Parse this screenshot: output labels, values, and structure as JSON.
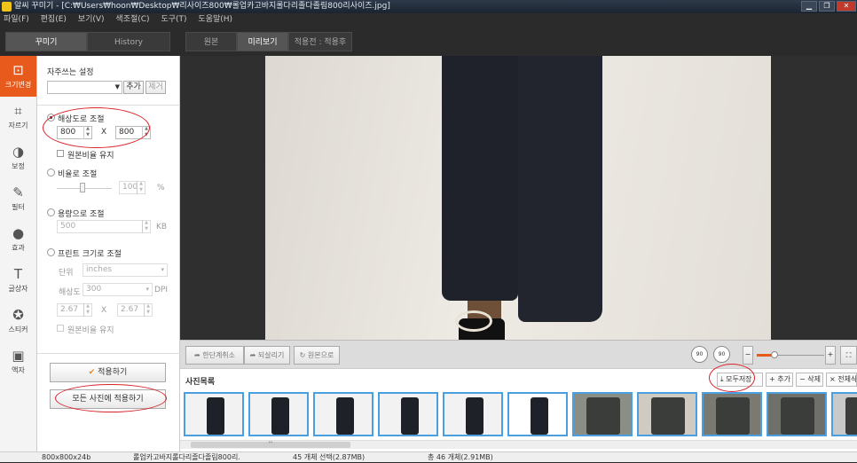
{
  "window": {
    "title": "알씨 꾸미기 - [C:₩Users₩hoon₩Desktop₩리사이즈800₩롤업카고바지롤다리졸다졸림800리사이즈.jpg]"
  },
  "menu": [
    "파일(F)",
    "편집(E)",
    "보기(V)",
    "색조절(C)",
    "도구(T)",
    "도움말(H)"
  ],
  "top_tabs": {
    "decorate": "꾸미기",
    "history": "History",
    "original": "원본",
    "preview": "미리보기",
    "applied": "적용전 : 적용후"
  },
  "sidebar": [
    {
      "label": "크기변경",
      "icon": "resize-icon"
    },
    {
      "label": "자르기",
      "icon": "crop-icon"
    },
    {
      "label": "보정",
      "icon": "adjust-icon"
    },
    {
      "label": "필터",
      "icon": "filter-icon"
    },
    {
      "label": "효과",
      "icon": "effect-icon"
    },
    {
      "label": "글상자",
      "icon": "text-icon"
    },
    {
      "label": "스티커",
      "icon": "sticker-icon"
    },
    {
      "label": "액자",
      "icon": "frame-icon"
    }
  ],
  "panel": {
    "presets_title": "자주쓰는 설정",
    "preset_value": "",
    "add": "추가",
    "remove": "제거",
    "resolution_label": "해상도로 조절",
    "width": "800",
    "x": "X",
    "height": "800",
    "keep_ratio": "원본비율 유지",
    "ratio_label": "비율로 조절",
    "ratio_value": "100",
    "ratio_unit": "%",
    "capacity_label": "용량으로 조절",
    "capacity_value": "500",
    "capacity_unit": "KB",
    "print_label": "프린트 크기로 조절",
    "unit_label": "단위",
    "unit_value": "inches",
    "resolution_field_label": "해상도",
    "dpi_value": "300",
    "dpi_unit": "DPI",
    "print_w": "2.67",
    "print_x": "X",
    "print_h": "2.67",
    "print_keep": "원본비율 유지",
    "apply": "적용하기",
    "apply_all": "모든 사진에 적용하기"
  },
  "toolbar": {
    "undo": "한단계취소",
    "redo": "되살리기",
    "reset": "원본으로",
    "rotate_left": "90",
    "rotate_right": "90",
    "zoom_minus": "−",
    "zoom_plus": "+"
  },
  "photolist": {
    "title": "사진목록",
    "save_all": "모두저장",
    "add": "+ 추가",
    "delete": "− 삭제",
    "delete_all": "× 전체삭제",
    "thumb_count": 11,
    "scroll_mark": "'''"
  },
  "status": {
    "dims": "800x800x24b",
    "filename": "롤업카고바지롤다리졸다졸림800리.",
    "selected": "45 개체 선택(2.87MB)",
    "total": "총 46 개체(2.91MB)"
  },
  "colors": {
    "accent": "#e85a1b",
    "annotation": "#d8232a",
    "thumb_border": "#4a9fe0"
  }
}
